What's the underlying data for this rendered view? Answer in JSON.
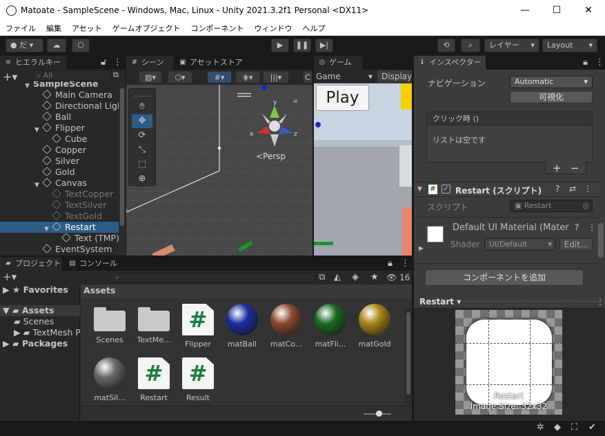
{
  "window": {
    "title": "Matoate - SampleScene - Windows, Mac, Linux - Unity 2021.3.2f1 Personal <DX11>",
    "minimize": "—",
    "maximize": "☐",
    "close": "✕"
  },
  "menu": [
    "ファイル",
    "編集",
    "アセット",
    "ゲームオブジェクト",
    "コンポーネント",
    "ウィンドウ",
    "ヘルプ"
  ],
  "toolbar": {
    "account_label": "だ",
    "layers_label": "レイヤー",
    "layout_label": "Layout"
  },
  "hierarchy": {
    "tab": "ヒエラルキー",
    "search_placeholder": "All",
    "items": [
      {
        "label": "SampleScene",
        "level": 0
      },
      {
        "label": "Main Camera",
        "level": 1
      },
      {
        "label": "Directional Light",
        "level": 1
      },
      {
        "label": "Ball",
        "level": 1
      },
      {
        "label": "Flipper",
        "level": 1
      },
      {
        "label": "Cube",
        "level": 2
      },
      {
        "label": "Copper",
        "level": 1
      },
      {
        "label": "Silver",
        "level": 1
      },
      {
        "label": "Gold",
        "level": 1
      },
      {
        "label": "Canvas",
        "level": 1
      },
      {
        "label": "TextCopper",
        "level": 2
      },
      {
        "label": "TextSilver",
        "level": 2
      },
      {
        "label": "TextGold",
        "level": 2
      },
      {
        "label": "Restart",
        "level": 2
      },
      {
        "label": "Text (TMP)",
        "level": 3
      },
      {
        "label": "EventSystem",
        "level": 1
      }
    ]
  },
  "scene": {
    "tab_scene": "シーン",
    "tab_asset_store": "アセットストア",
    "persp_label": "<Persp",
    "gizmo_x": "x",
    "gizmo_y": "y",
    "gizmo_z": "z"
  },
  "game": {
    "tab": "ゲーム",
    "display_select": "Game",
    "display_label": "Display",
    "play_button": "Play"
  },
  "inspector": {
    "tab": "インスペクター",
    "navigation_label": "ナビゲーション",
    "navigation_value": "Automatic",
    "visualize_button": "可視化",
    "on_click_label": "クリック時 ()",
    "list_empty": "リストは空です",
    "plus": "+",
    "minus": "−",
    "component_title": "Restart (スクリプト)",
    "script_label": "スクリプト",
    "script_value": "Restart",
    "material_name": "Default UI Material (Material)",
    "shader_label": "Shader",
    "shader_value": "UI/Default",
    "edit_button": "Edit...",
    "add_component_button": "コンポーネントを追加",
    "preview_title": "Restart",
    "preview_caption": "Restart",
    "preview_size": "Image Size: 32x32"
  },
  "project": {
    "tab_project": "プロジェクト",
    "tab_console": "コンソール",
    "hidden_count": "16",
    "favorites": "Favorites",
    "assets_root": "Assets",
    "folders": [
      "Scenes",
      "TextMesh Pro"
    ],
    "packages": "Packages",
    "breadcrumb": "Assets",
    "assets": [
      {
        "label": "Scenes",
        "kind": "folder"
      },
      {
        "label": "TextMe...",
        "kind": "folder"
      },
      {
        "label": "Flipper",
        "kind": "script"
      },
      {
        "label": "matBall",
        "kind": "material",
        "color": "#1d2ea0"
      },
      {
        "label": "matCo...",
        "kind": "material",
        "color": "#8a4a34"
      },
      {
        "label": "matFli...",
        "kind": "material",
        "color": "#1d6a22"
      },
      {
        "label": "matGold",
        "kind": "material",
        "color": "#a88416"
      },
      {
        "label": "matSil...",
        "kind": "material",
        "color": "#6a6a6a"
      },
      {
        "label": "Restart",
        "kind": "script"
      },
      {
        "label": "Result",
        "kind": "script"
      }
    ]
  },
  "colors": {
    "selection": "#2c5d87",
    "accent_blue": "#3a79bb",
    "game_sky": "#c7d4e2",
    "game_ground": "#a1a7ad"
  }
}
